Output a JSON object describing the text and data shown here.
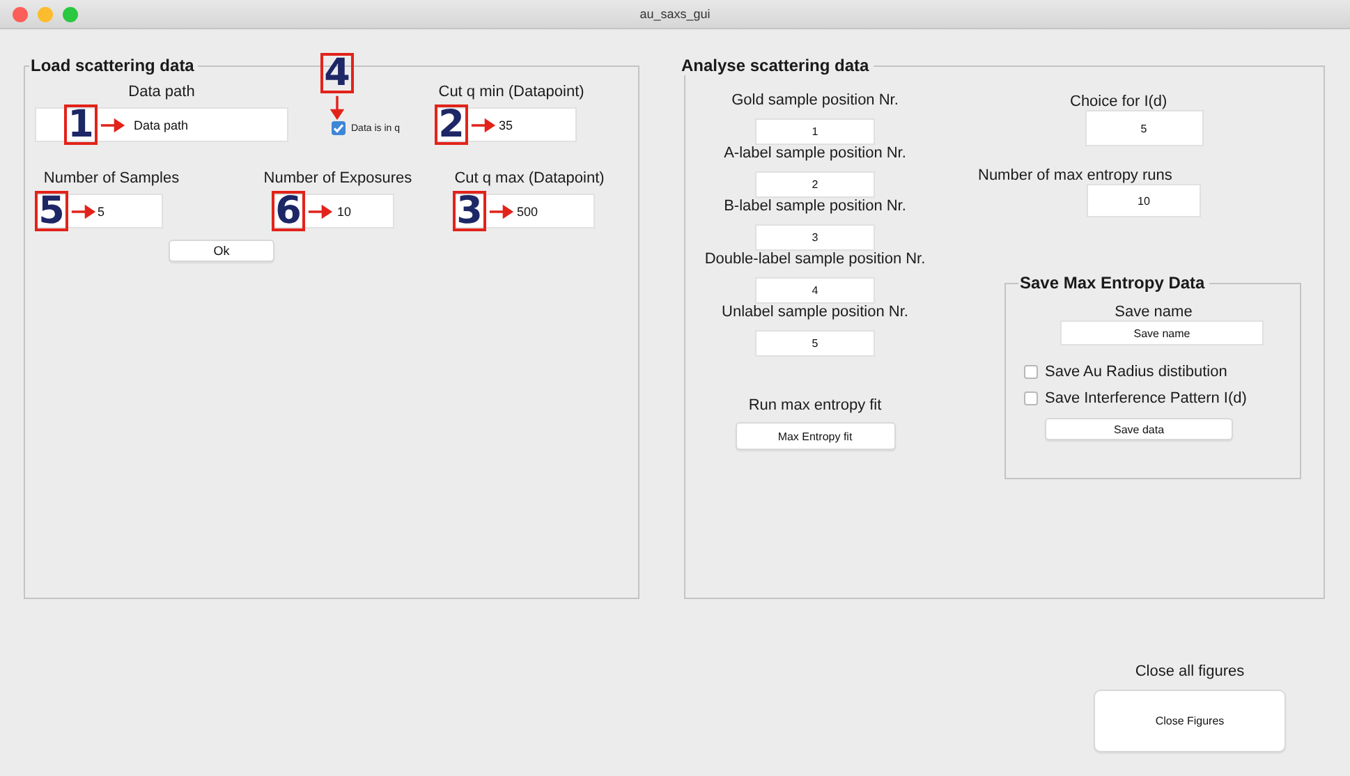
{
  "window": {
    "title": "au_saxs_gui"
  },
  "load_panel": {
    "title": "Load scattering data",
    "fields": [
      {
        "kind": "path",
        "label": "Data path",
        "value": "Data path",
        "marker": "1"
      },
      {
        "kind": "checkbox",
        "label": "Data is in q",
        "checked": true,
        "marker": "4"
      },
      {
        "kind": "q_min",
        "label": "Cut q min (Datapoint)",
        "value": "35",
        "marker": "2"
      },
      {
        "kind": "samples",
        "label": "Number of Samples",
        "value": "5",
        "marker": "5"
      },
      {
        "kind": "exposures",
        "label": "Number of Exposures",
        "value": "10",
        "marker": "6"
      },
      {
        "kind": "q_max",
        "label": "Cut q max (Datapoint)",
        "value": "500",
        "marker": "3"
      }
    ],
    "ok_button": "Ok"
  },
  "analyse_panel": {
    "title": "Analyse scattering data",
    "positions": [
      {
        "label": "Gold sample position Nr.",
        "value": "1"
      },
      {
        "label": "A-label sample position Nr.",
        "value": "2"
      },
      {
        "label": "B-label sample position Nr.",
        "value": "3"
      },
      {
        "label": "Double-label sample position Nr.",
        "value": "4"
      },
      {
        "label": "Unlabel sample position Nr.",
        "value": "5"
      }
    ],
    "run_label": "Run max entropy fit",
    "run_button": "Max Entropy fit",
    "choice": {
      "label": "Choice for I(d)",
      "value": "5"
    },
    "runs": {
      "label": "Number of max entropy runs",
      "value": "10"
    },
    "save_panel": {
      "title": "Save Max Entropy Data",
      "name_label": "Save name",
      "name_value": "Save name",
      "checkboxes": [
        {
          "label": "Save Au Radius distibution",
          "checked": false
        },
        {
          "label": "Save Interference Pattern I(d)",
          "checked": false
        }
      ],
      "save_button": "Save data"
    }
  },
  "close": {
    "label": "Close all figures",
    "button": "Close Figures"
  }
}
